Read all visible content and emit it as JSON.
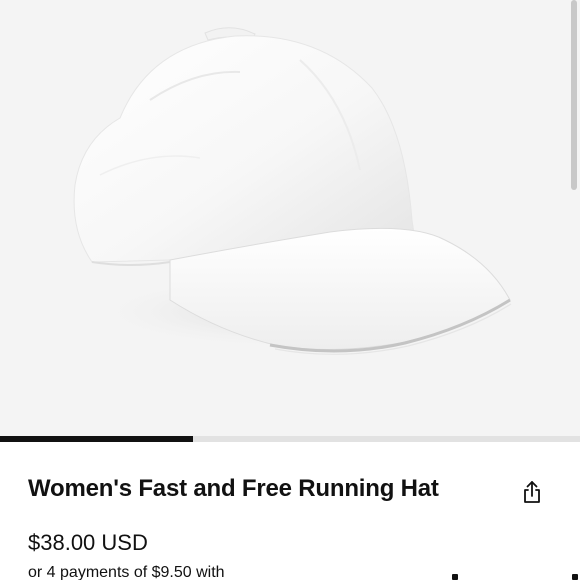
{
  "product": {
    "image_icon": "cap-icon",
    "image_alt": "Women's Fast and Free Running Hat",
    "name": "Women's Fast and Free Running Hat",
    "price": "$38.00 USD",
    "installments": "or 4 payments of $9.50 with"
  },
  "carousel": {
    "progress_fraction": 0.333
  },
  "actions": {
    "share_icon": "share-icon"
  },
  "colors": {
    "image_background": "#f4f4f4",
    "text": "#111111",
    "progress_active": "#111111",
    "progress_track": "#e2e2e2"
  }
}
